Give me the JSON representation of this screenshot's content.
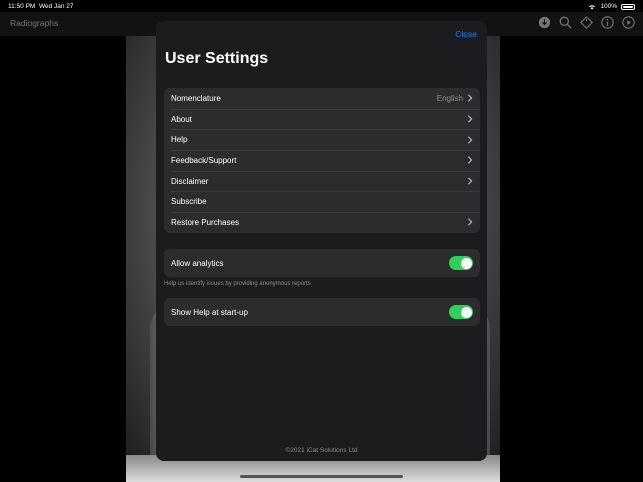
{
  "status_bar": {
    "time": "11:50 PM",
    "date": "Wed Jan 27",
    "battery": "100%"
  },
  "app_bar": {
    "left_title": "Radiographs"
  },
  "modal": {
    "close_label": "Close",
    "title": "User Settings",
    "menu_items": [
      {
        "label": "Nomenclature",
        "value": "English"
      },
      {
        "label": "About"
      },
      {
        "label": "Help"
      },
      {
        "label": "Feedback/Support"
      },
      {
        "label": "Disclaimer"
      },
      {
        "label": "Subscribe"
      },
      {
        "label": "Restore Purchases"
      }
    ],
    "analytics": {
      "label": "Allow analytics",
      "enabled": true,
      "footnote": "Help us identify issues by providing anonymous reports"
    },
    "show_help": {
      "label": "Show Help at start-up",
      "enabled": true
    },
    "copyright": "©2021 iCat Solutions Ltd"
  },
  "colors": {
    "accent": "#0a84ff",
    "toggle_on": "#30d158",
    "panel": "#1c1c1e",
    "cell": "#2c2c2e"
  },
  "icons": [
    "download-icon",
    "search-icon",
    "tag-icon",
    "info-icon",
    "play-icon",
    "chevron-right-icon",
    "wifi-icon",
    "battery-icon"
  ]
}
